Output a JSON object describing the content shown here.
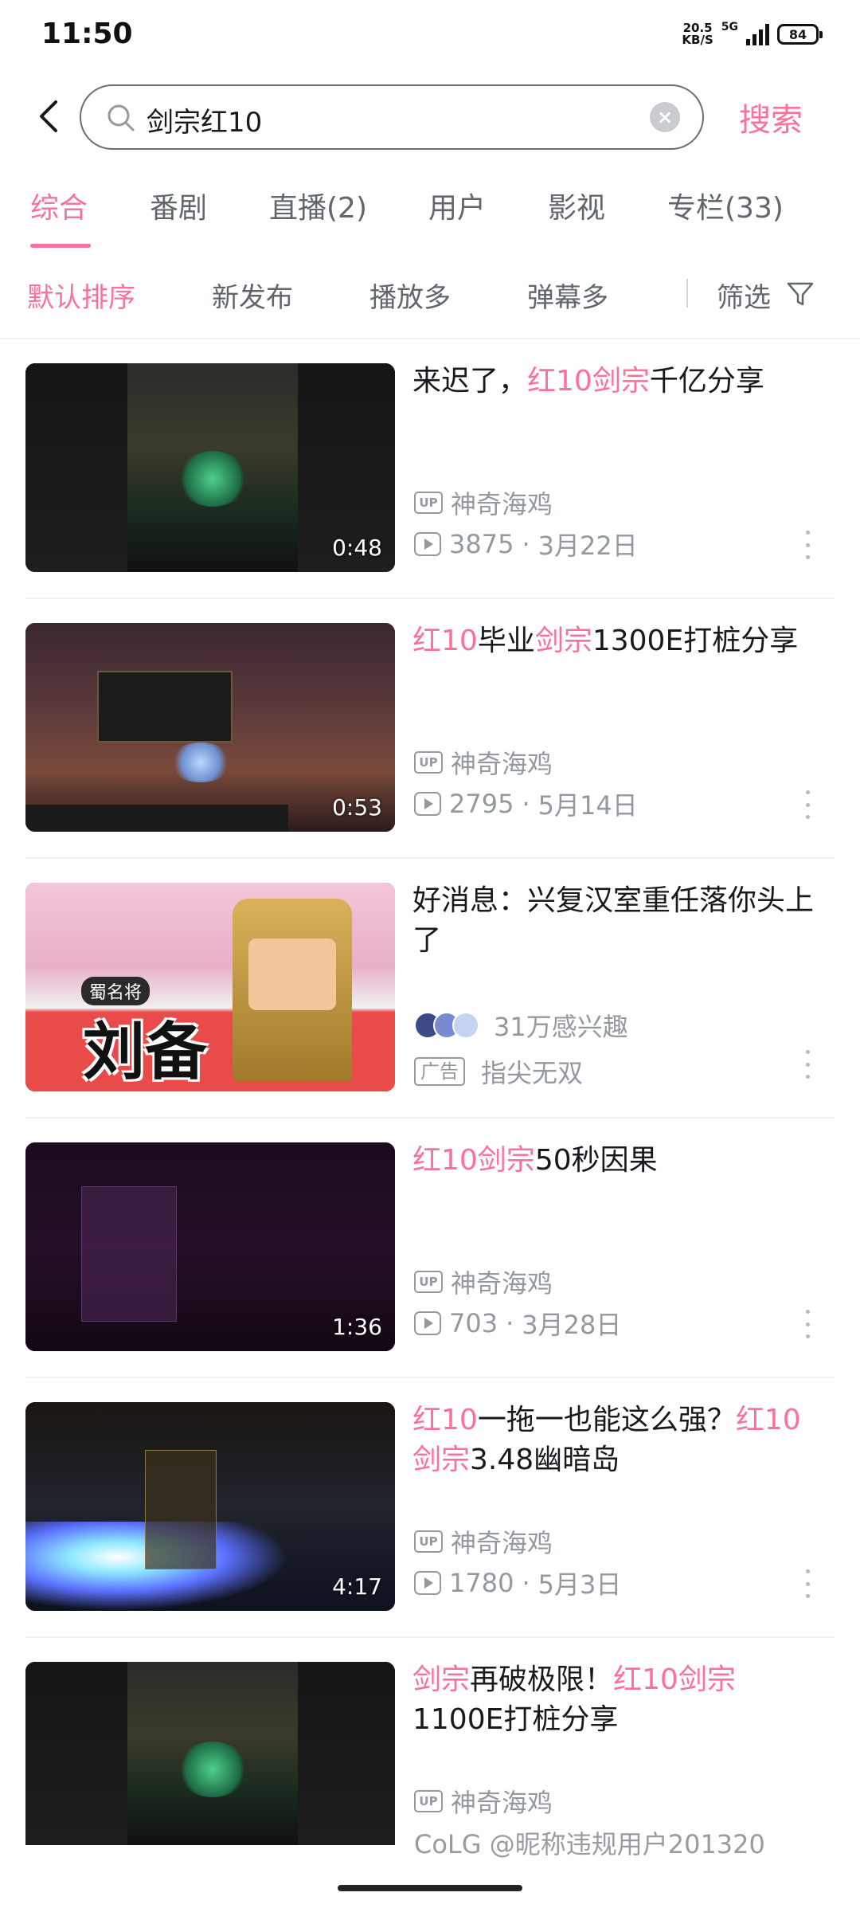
{
  "status_bar": {
    "time": "11:50",
    "net_speed_value": "20.5",
    "net_speed_unit": "KB/S",
    "network": "5G",
    "battery": "84"
  },
  "search": {
    "query": "剑宗红10",
    "submit_label": "搜索"
  },
  "tabs": [
    {
      "label": "综合",
      "active": true
    },
    {
      "label": "番剧"
    },
    {
      "label": "直播(2)"
    },
    {
      "label": "用户"
    },
    {
      "label": "影视"
    },
    {
      "label": "专栏(33)"
    }
  ],
  "sort_options": [
    {
      "label": "默认排序",
      "active": true
    },
    {
      "label": "新发布"
    },
    {
      "label": "播放多"
    },
    {
      "label": "弹幕多"
    }
  ],
  "filter_label": "筛选",
  "results": [
    {
      "title_parts": [
        "来迟了，",
        "红10剑宗",
        "千亿分享"
      ],
      "highlight": [
        false,
        true,
        false
      ],
      "up_badge": "UP",
      "uploader": "神奇海鸡",
      "plays": "3875",
      "date": "3月22日",
      "duration": "0:48"
    },
    {
      "title_parts": [
        "红10",
        "毕业",
        "剑宗",
        "1300E打桩分享"
      ],
      "highlight": [
        true,
        false,
        true,
        false
      ],
      "up_badge": "UP",
      "uploader": "神奇海鸡",
      "plays": "2795",
      "date": "5月14日",
      "duration": "0:53"
    },
    {
      "title_parts": [
        "好消息：兴复汉室重任落你头上了"
      ],
      "highlight": [
        false
      ],
      "interest": "31万感兴趣",
      "ad_badge": "广告",
      "advertiser": "指尖无双",
      "ad_thumb_text_1": "蜀名将",
      "ad_thumb_text_2": "刘备"
    },
    {
      "title_parts": [
        "红10剑宗",
        "50秒因果"
      ],
      "highlight": [
        true,
        false
      ],
      "up_badge": "UP",
      "uploader": "神奇海鸡",
      "plays": "703",
      "date": "3月28日",
      "duration": "1:36"
    },
    {
      "title_parts": [
        "红10",
        "一拖一也能这么强？",
        "红10剑宗",
        "3.48幽暗岛"
      ],
      "highlight": [
        true,
        false,
        true,
        false
      ],
      "up_badge": "UP",
      "uploader": "神奇海鸡",
      "plays": "1780",
      "date": "5月3日",
      "duration": "4:17"
    },
    {
      "title_parts": [
        "剑宗",
        "再破极限！",
        "红10剑宗",
        "1100E打桩分享"
      ],
      "highlight": [
        true,
        false,
        true,
        false
      ],
      "up_badge": "UP",
      "uploader": "神奇海鸡"
    }
  ],
  "watermark": "CoLG @昵称违规用户201320",
  "colors": {
    "accent": "#fb7299",
    "text_primary": "#18191c",
    "text_secondary": "#61666d",
    "text_muted": "#9499a0"
  }
}
